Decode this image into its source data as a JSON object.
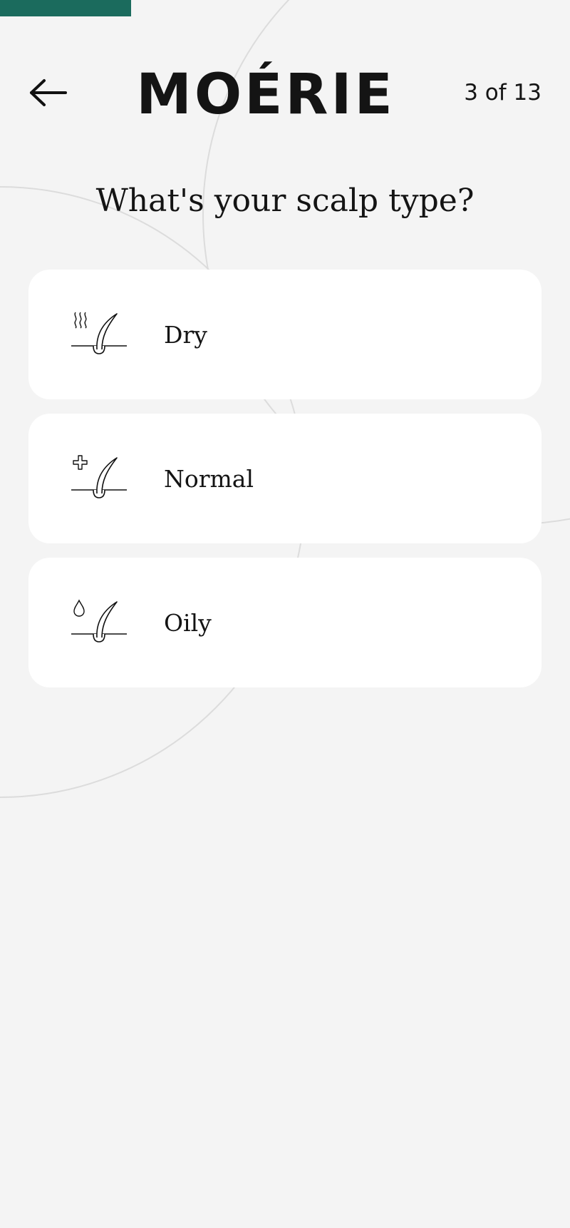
{
  "progress": {
    "fraction": 0.23,
    "color": "#1b6b5d"
  },
  "header": {
    "back_icon": "arrow-left-icon",
    "logo": "MOÉRIE",
    "step_counter": "3 of 13"
  },
  "question": {
    "title": "What's your scalp type?"
  },
  "options": [
    {
      "label": "Dry",
      "icon": "dry-scalp-icon"
    },
    {
      "label": "Normal",
      "icon": "normal-scalp-icon"
    },
    {
      "label": "Oily",
      "icon": "oily-scalp-icon"
    }
  ]
}
